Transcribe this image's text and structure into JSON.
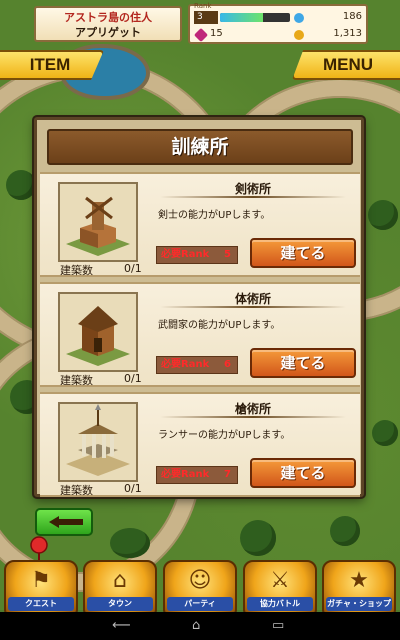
{
  "hud": {
    "island_line1": "アストラ島の住人",
    "island_line2": "アプリゲット",
    "rank_tag": "Rank",
    "rank": "3",
    "exp_fraction": 0.62,
    "stat_top_right": "186",
    "gems": "15",
    "coins": "1,313"
  },
  "top_buttons": {
    "item": "ITEM",
    "menu": "MENU"
  },
  "dialog": {
    "title": "訓練所",
    "count_label": "建築数",
    "rank_label": "必要Rank",
    "facilities": [
      {
        "name": "剣術所",
        "desc": "剣士の能力がUPします。",
        "count": "0/1",
        "rank": "5",
        "button": "建てる"
      },
      {
        "name": "体術所",
        "desc": "武闘家の能力がUPします。",
        "count": "0/1",
        "rank": "6",
        "button": "建てる"
      },
      {
        "name": "槍術所",
        "desc": "ランサーの能力がUPします。",
        "count": "0/1",
        "rank": "7",
        "button": "建てる"
      }
    ]
  },
  "nav": [
    {
      "label": "クエスト",
      "icon": "quest-icon"
    },
    {
      "label": "タウン",
      "icon": "town-icon"
    },
    {
      "label": "パーティ",
      "icon": "party-icon"
    },
    {
      "label": "協力バトル",
      "icon": "coop-battle-icon"
    },
    {
      "label": "ガチャ・ショップ",
      "icon": "gacha-shop-icon"
    }
  ],
  "colors": {
    "build_button": "#d1561a",
    "rank_required_text": "#ff2a2a",
    "back_button": "#2fa51c"
  }
}
